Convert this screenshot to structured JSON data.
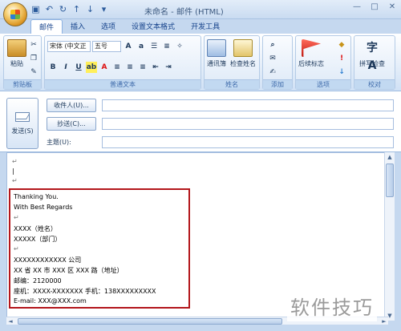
{
  "window": {
    "title": "未命名 - 邮件 (HTML)",
    "controls": [
      "—",
      "□",
      "✕"
    ]
  },
  "quick_access": [
    "save-icon",
    "undo-icon",
    "redo-icon",
    "up-icon",
    "down-icon",
    "customize-icon"
  ],
  "tabs": [
    "邮件",
    "插入",
    "选项",
    "设置文本格式",
    "开发工具"
  ],
  "ribbon": {
    "clipboard": {
      "paste_label": "粘贴",
      "group_label": "剪贴板"
    },
    "text": {
      "font_name": "宋体 (中文正",
      "font_size": "五号",
      "bold": "B",
      "italic": "I",
      "underline": "U",
      "highlight_icon": "ab",
      "font_color_icon": "A",
      "group_label": "普通文本"
    },
    "names": {
      "address_book": "通讯簿",
      "check_names": "检查姓名",
      "group_label": "姓名"
    },
    "include": {
      "group_label": "添加"
    },
    "options": {
      "follow_up": "后续标志",
      "group_label": "选项"
    },
    "proofing": {
      "spelling": "拼写检查",
      "group_label": "校对"
    }
  },
  "header": {
    "send": "发送(S)",
    "to": "收件人(U)...",
    "cc": "抄送(C)...",
    "subject": "主题(U):"
  },
  "body": {
    "lines": [
      "Thanking You.",
      "With Best Regards",
      "",
      "XXXX（姓名）",
      "XXXXX（部门）",
      "",
      "XXXXXXXXXXXX 公司",
      "XX 省 XX 市 XXX 区 XXX 路（地址）",
      "邮编：2120000",
      "座机：XXXX-XXXXXXX  手机：138XXXXXXXXX",
      "E-mail:  XXX@XXX.com"
    ]
  },
  "watermark": "软件技巧",
  "colors": {
    "highlight_box": "#b3161b"
  }
}
